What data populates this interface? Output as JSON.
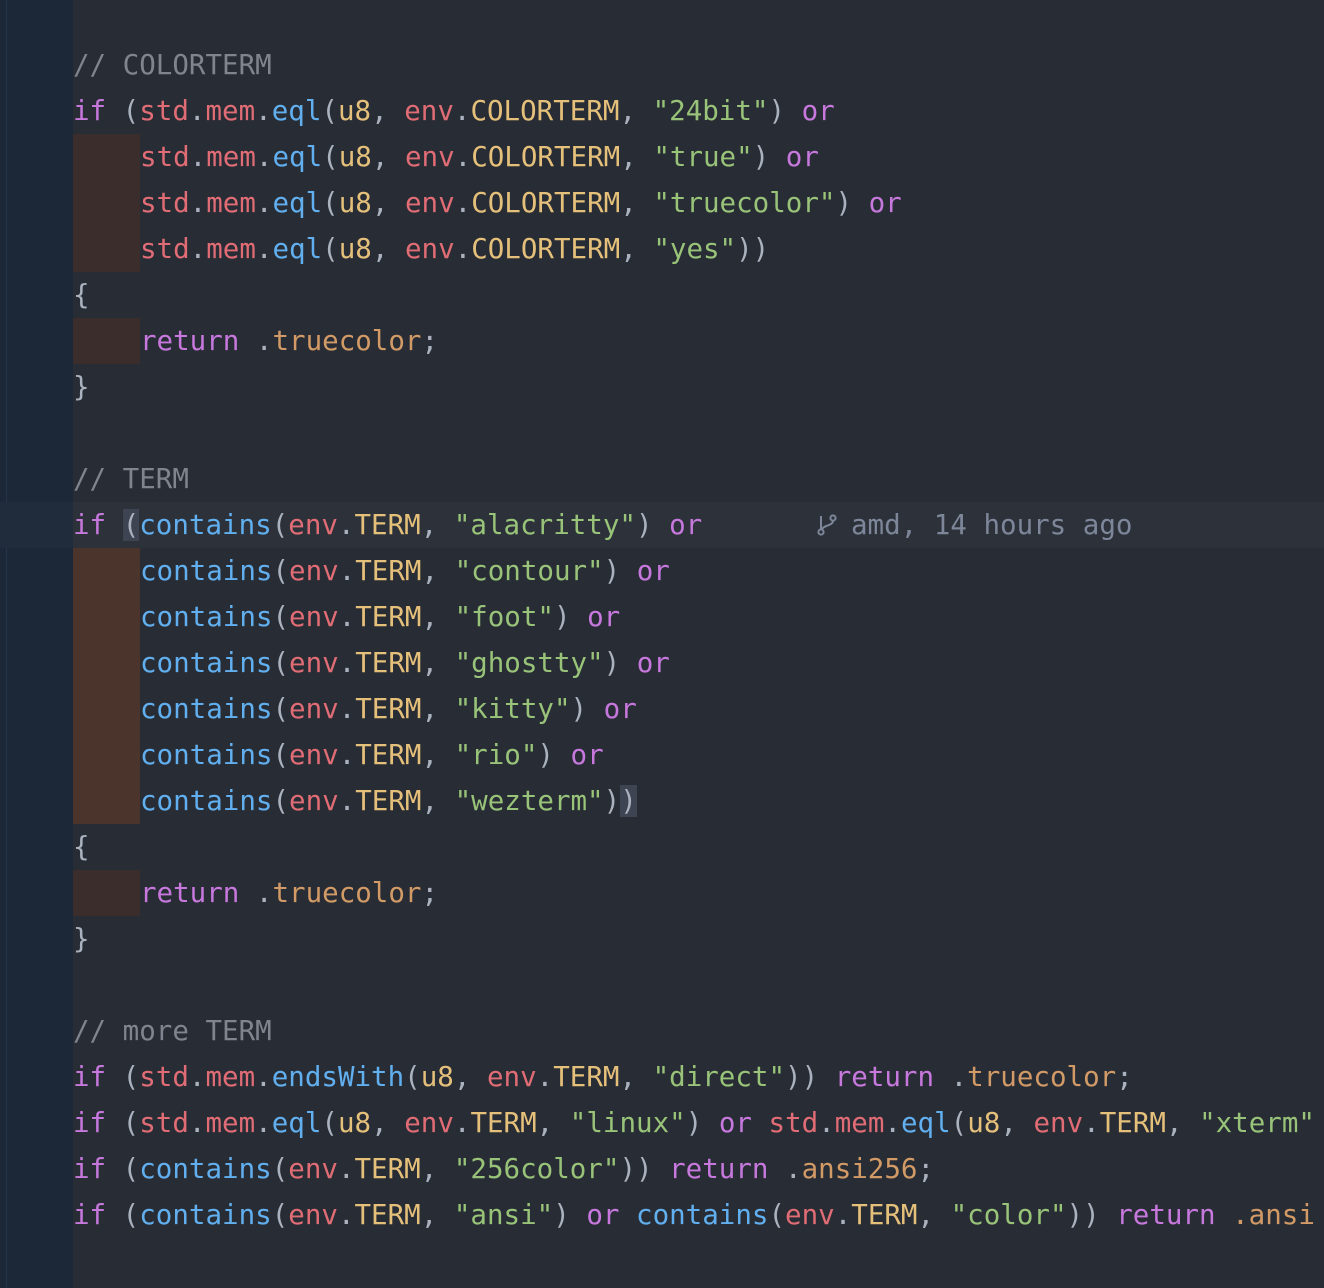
{
  "editor": {
    "theme_colors": {
      "background": "#282c34",
      "gutter": "#1c2838",
      "keyword": "#c678dd",
      "comment": "#7f848e",
      "variable": "#e06c75",
      "function": "#61afef",
      "string": "#98c379",
      "type": "#e5c07b",
      "enum": "#d19a66"
    },
    "blame": {
      "icon": "git-branch-icon",
      "text": "amd, 14 hours ago"
    },
    "lines": [
      {
        "indent": 0,
        "tokens": [
          {
            "t": "// COLORTERM",
            "c": "c"
          }
        ]
      },
      {
        "indent": 0,
        "tokens": [
          {
            "t": "if",
            "c": "k"
          },
          {
            "t": " (",
            "c": "p"
          },
          {
            "t": "std",
            "c": "v"
          },
          {
            "t": ".",
            "c": "p"
          },
          {
            "t": "mem",
            "c": "v"
          },
          {
            "t": ".",
            "c": "p"
          },
          {
            "t": "eql",
            "c": "f"
          },
          {
            "t": "(",
            "c": "p"
          },
          {
            "t": "u8",
            "c": "t"
          },
          {
            "t": ", ",
            "c": "p"
          },
          {
            "t": "env",
            "c": "v"
          },
          {
            "t": ".",
            "c": "p"
          },
          {
            "t": "COLORTERM",
            "c": "t"
          },
          {
            "t": ", ",
            "c": "p"
          },
          {
            "t": "\"24bit\"",
            "c": "s"
          },
          {
            "t": ") ",
            "c": "p"
          },
          {
            "t": "or",
            "c": "k"
          }
        ]
      },
      {
        "indent": 1,
        "tokens": [
          {
            "t": "std",
            "c": "v"
          },
          {
            "t": ".",
            "c": "p"
          },
          {
            "t": "mem",
            "c": "v"
          },
          {
            "t": ".",
            "c": "p"
          },
          {
            "t": "eql",
            "c": "f"
          },
          {
            "t": "(",
            "c": "p"
          },
          {
            "t": "u8",
            "c": "t"
          },
          {
            "t": ", ",
            "c": "p"
          },
          {
            "t": "env",
            "c": "v"
          },
          {
            "t": ".",
            "c": "p"
          },
          {
            "t": "COLORTERM",
            "c": "t"
          },
          {
            "t": ", ",
            "c": "p"
          },
          {
            "t": "\"true\"",
            "c": "s"
          },
          {
            "t": ") ",
            "c": "p"
          },
          {
            "t": "or",
            "c": "k"
          }
        ]
      },
      {
        "indent": 1,
        "tokens": [
          {
            "t": "std",
            "c": "v"
          },
          {
            "t": ".",
            "c": "p"
          },
          {
            "t": "mem",
            "c": "v"
          },
          {
            "t": ".",
            "c": "p"
          },
          {
            "t": "eql",
            "c": "f"
          },
          {
            "t": "(",
            "c": "p"
          },
          {
            "t": "u8",
            "c": "t"
          },
          {
            "t": ", ",
            "c": "p"
          },
          {
            "t": "env",
            "c": "v"
          },
          {
            "t": ".",
            "c": "p"
          },
          {
            "t": "COLORTERM",
            "c": "t"
          },
          {
            "t": ", ",
            "c": "p"
          },
          {
            "t": "\"truecolor\"",
            "c": "s"
          },
          {
            "t": ") ",
            "c": "p"
          },
          {
            "t": "or",
            "c": "k"
          }
        ]
      },
      {
        "indent": 1,
        "tokens": [
          {
            "t": "std",
            "c": "v"
          },
          {
            "t": ".",
            "c": "p"
          },
          {
            "t": "mem",
            "c": "v"
          },
          {
            "t": ".",
            "c": "p"
          },
          {
            "t": "eql",
            "c": "f"
          },
          {
            "t": "(",
            "c": "p"
          },
          {
            "t": "u8",
            "c": "t"
          },
          {
            "t": ", ",
            "c": "p"
          },
          {
            "t": "env",
            "c": "v"
          },
          {
            "t": ".",
            "c": "p"
          },
          {
            "t": "COLORTERM",
            "c": "t"
          },
          {
            "t": ", ",
            "c": "p"
          },
          {
            "t": "\"yes\"",
            "c": "s"
          },
          {
            "t": "))",
            "c": "p"
          }
        ]
      },
      {
        "indent": 0,
        "tokens": [
          {
            "t": "{",
            "c": "p"
          }
        ]
      },
      {
        "indent": 1,
        "tokens": [
          {
            "t": "return",
            "c": "k"
          },
          {
            "t": " .",
            "c": "p"
          },
          {
            "t": "truecolor",
            "c": "e"
          },
          {
            "t": ";",
            "c": "p"
          }
        ]
      },
      {
        "indent": 0,
        "tokens": [
          {
            "t": "}",
            "c": "p"
          }
        ]
      },
      {
        "indent": 0,
        "tokens": []
      },
      {
        "indent": 0,
        "tokens": [
          {
            "t": "// TERM",
            "c": "c"
          }
        ]
      },
      {
        "indent": 0,
        "current": true,
        "blame": true,
        "tokens": [
          {
            "t": "if",
            "c": "k"
          },
          {
            "t": " ",
            "c": "p"
          },
          {
            "t": "(",
            "c": "p",
            "hl": "cursor-bg"
          },
          {
            "t": "contains",
            "c": "f"
          },
          {
            "t": "(",
            "c": "p"
          },
          {
            "t": "env",
            "c": "v"
          },
          {
            "t": ".",
            "c": "p"
          },
          {
            "t": "TERM",
            "c": "t"
          },
          {
            "t": ", ",
            "c": "p"
          },
          {
            "t": "\"alacritty\"",
            "c": "s"
          },
          {
            "t": ") ",
            "c": "p"
          },
          {
            "t": "or",
            "c": "k"
          }
        ]
      },
      {
        "indent": 2,
        "tokens": [
          {
            "t": "contains",
            "c": "f"
          },
          {
            "t": "(",
            "c": "p"
          },
          {
            "t": "env",
            "c": "v"
          },
          {
            "t": ".",
            "c": "p"
          },
          {
            "t": "TERM",
            "c": "t"
          },
          {
            "t": ", ",
            "c": "p"
          },
          {
            "t": "\"contour\"",
            "c": "s"
          },
          {
            "t": ") ",
            "c": "p"
          },
          {
            "t": "or",
            "c": "k"
          }
        ]
      },
      {
        "indent": 2,
        "tokens": [
          {
            "t": "contains",
            "c": "f"
          },
          {
            "t": "(",
            "c": "p"
          },
          {
            "t": "env",
            "c": "v"
          },
          {
            "t": ".",
            "c": "p"
          },
          {
            "t": "TERM",
            "c": "t"
          },
          {
            "t": ", ",
            "c": "p"
          },
          {
            "t": "\"foot\"",
            "c": "s"
          },
          {
            "t": ") ",
            "c": "p"
          },
          {
            "t": "or",
            "c": "k"
          }
        ]
      },
      {
        "indent": 2,
        "tokens": [
          {
            "t": "contains",
            "c": "f"
          },
          {
            "t": "(",
            "c": "p"
          },
          {
            "t": "env",
            "c": "v"
          },
          {
            "t": ".",
            "c": "p"
          },
          {
            "t": "TERM",
            "c": "t"
          },
          {
            "t": ", ",
            "c": "p"
          },
          {
            "t": "\"ghostty\"",
            "c": "s"
          },
          {
            "t": ") ",
            "c": "p"
          },
          {
            "t": "or",
            "c": "k"
          }
        ]
      },
      {
        "indent": 2,
        "tokens": [
          {
            "t": "contains",
            "c": "f"
          },
          {
            "t": "(",
            "c": "p"
          },
          {
            "t": "env",
            "c": "v"
          },
          {
            "t": ".",
            "c": "p"
          },
          {
            "t": "TERM",
            "c": "t"
          },
          {
            "t": ", ",
            "c": "p"
          },
          {
            "t": "\"kitty\"",
            "c": "s"
          },
          {
            "t": ") ",
            "c": "p"
          },
          {
            "t": "or",
            "c": "k"
          }
        ]
      },
      {
        "indent": 2,
        "tokens": [
          {
            "t": "contains",
            "c": "f"
          },
          {
            "t": "(",
            "c": "p"
          },
          {
            "t": "env",
            "c": "v"
          },
          {
            "t": ".",
            "c": "p"
          },
          {
            "t": "TERM",
            "c": "t"
          },
          {
            "t": ", ",
            "c": "p"
          },
          {
            "t": "\"rio\"",
            "c": "s"
          },
          {
            "t": ") ",
            "c": "p"
          },
          {
            "t": "or",
            "c": "k"
          }
        ]
      },
      {
        "indent": 2,
        "tokens": [
          {
            "t": "contains",
            "c": "f"
          },
          {
            "t": "(",
            "c": "p"
          },
          {
            "t": "env",
            "c": "v"
          },
          {
            "t": ".",
            "c": "p"
          },
          {
            "t": "TERM",
            "c": "t"
          },
          {
            "t": ", ",
            "c": "p"
          },
          {
            "t": "\"wezterm\"",
            "c": "s"
          },
          {
            "t": ")",
            "c": "p"
          },
          {
            "t": ")",
            "c": "p",
            "hl": "bracket-bg"
          }
        ]
      },
      {
        "indent": 0,
        "tokens": [
          {
            "t": "{",
            "c": "p"
          }
        ]
      },
      {
        "indent": 1,
        "tokens": [
          {
            "t": "return",
            "c": "k"
          },
          {
            "t": " .",
            "c": "p"
          },
          {
            "t": "truecolor",
            "c": "e"
          },
          {
            "t": ";",
            "c": "p"
          }
        ]
      },
      {
        "indent": 0,
        "tokens": [
          {
            "t": "}",
            "c": "p"
          }
        ]
      },
      {
        "indent": 0,
        "tokens": []
      },
      {
        "indent": 0,
        "tokens": [
          {
            "t": "// more TERM",
            "c": "c"
          }
        ]
      },
      {
        "indent": 0,
        "tokens": [
          {
            "t": "if",
            "c": "k"
          },
          {
            "t": " (",
            "c": "p"
          },
          {
            "t": "std",
            "c": "v"
          },
          {
            "t": ".",
            "c": "p"
          },
          {
            "t": "mem",
            "c": "v"
          },
          {
            "t": ".",
            "c": "p"
          },
          {
            "t": "endsWith",
            "c": "f"
          },
          {
            "t": "(",
            "c": "p"
          },
          {
            "t": "u8",
            "c": "t"
          },
          {
            "t": ", ",
            "c": "p"
          },
          {
            "t": "env",
            "c": "v"
          },
          {
            "t": ".",
            "c": "p"
          },
          {
            "t": "TERM",
            "c": "t"
          },
          {
            "t": ", ",
            "c": "p"
          },
          {
            "t": "\"direct\"",
            "c": "s"
          },
          {
            "t": ")) ",
            "c": "p"
          },
          {
            "t": "return",
            "c": "k"
          },
          {
            "t": " .",
            "c": "p"
          },
          {
            "t": "truecolor",
            "c": "e"
          },
          {
            "t": ";",
            "c": "p"
          }
        ]
      },
      {
        "indent": 0,
        "tokens": [
          {
            "t": "if",
            "c": "k"
          },
          {
            "t": " (",
            "c": "p"
          },
          {
            "t": "std",
            "c": "v"
          },
          {
            "t": ".",
            "c": "p"
          },
          {
            "t": "mem",
            "c": "v"
          },
          {
            "t": ".",
            "c": "p"
          },
          {
            "t": "eql",
            "c": "f"
          },
          {
            "t": "(",
            "c": "p"
          },
          {
            "t": "u8",
            "c": "t"
          },
          {
            "t": ", ",
            "c": "p"
          },
          {
            "t": "env",
            "c": "v"
          },
          {
            "t": ".",
            "c": "p"
          },
          {
            "t": "TERM",
            "c": "t"
          },
          {
            "t": ", ",
            "c": "p"
          },
          {
            "t": "\"linux\"",
            "c": "s"
          },
          {
            "t": ") ",
            "c": "p"
          },
          {
            "t": "or",
            "c": "k"
          },
          {
            "t": " ",
            "c": "p"
          },
          {
            "t": "std",
            "c": "v"
          },
          {
            "t": ".",
            "c": "p"
          },
          {
            "t": "mem",
            "c": "v"
          },
          {
            "t": ".",
            "c": "p"
          },
          {
            "t": "eql",
            "c": "f"
          },
          {
            "t": "(",
            "c": "p"
          },
          {
            "t": "u8",
            "c": "t"
          },
          {
            "t": ", ",
            "c": "p"
          },
          {
            "t": "env",
            "c": "v"
          },
          {
            "t": ".",
            "c": "p"
          },
          {
            "t": "TERM",
            "c": "t"
          },
          {
            "t": ", ",
            "c": "p"
          },
          {
            "t": "\"xterm\"",
            "c": "s"
          }
        ]
      },
      {
        "indent": 0,
        "tokens": [
          {
            "t": "if",
            "c": "k"
          },
          {
            "t": " (",
            "c": "p"
          },
          {
            "t": "contains",
            "c": "f"
          },
          {
            "t": "(",
            "c": "p"
          },
          {
            "t": "env",
            "c": "v"
          },
          {
            "t": ".",
            "c": "p"
          },
          {
            "t": "TERM",
            "c": "t"
          },
          {
            "t": ", ",
            "c": "p"
          },
          {
            "t": "\"256color\"",
            "c": "s"
          },
          {
            "t": ")) ",
            "c": "p"
          },
          {
            "t": "return",
            "c": "k"
          },
          {
            "t": " .",
            "c": "p"
          },
          {
            "t": "ansi256",
            "c": "e"
          },
          {
            "t": ";",
            "c": "p"
          }
        ]
      },
      {
        "indent": 0,
        "tokens": [
          {
            "t": "if",
            "c": "k"
          },
          {
            "t": " (",
            "c": "p"
          },
          {
            "t": "contains",
            "c": "f"
          },
          {
            "t": "(",
            "c": "p"
          },
          {
            "t": "env",
            "c": "v"
          },
          {
            "t": ".",
            "c": "p"
          },
          {
            "t": "TERM",
            "c": "t"
          },
          {
            "t": ", ",
            "c": "p"
          },
          {
            "t": "\"ansi\"",
            "c": "s"
          },
          {
            "t": ") ",
            "c": "p"
          },
          {
            "t": "or",
            "c": "k"
          },
          {
            "t": " ",
            "c": "p"
          },
          {
            "t": "contains",
            "c": "f"
          },
          {
            "t": "(",
            "c": "p"
          },
          {
            "t": "env",
            "c": "v"
          },
          {
            "t": ".",
            "c": "p"
          },
          {
            "t": "TERM",
            "c": "t"
          },
          {
            "t": ", ",
            "c": "p"
          },
          {
            "t": "\"color\"",
            "c": "s"
          },
          {
            "t": ")) ",
            "c": "p"
          },
          {
            "t": "return",
            "c": "k"
          },
          {
            "t": " .ansi",
            "c": "e"
          }
        ]
      }
    ]
  }
}
